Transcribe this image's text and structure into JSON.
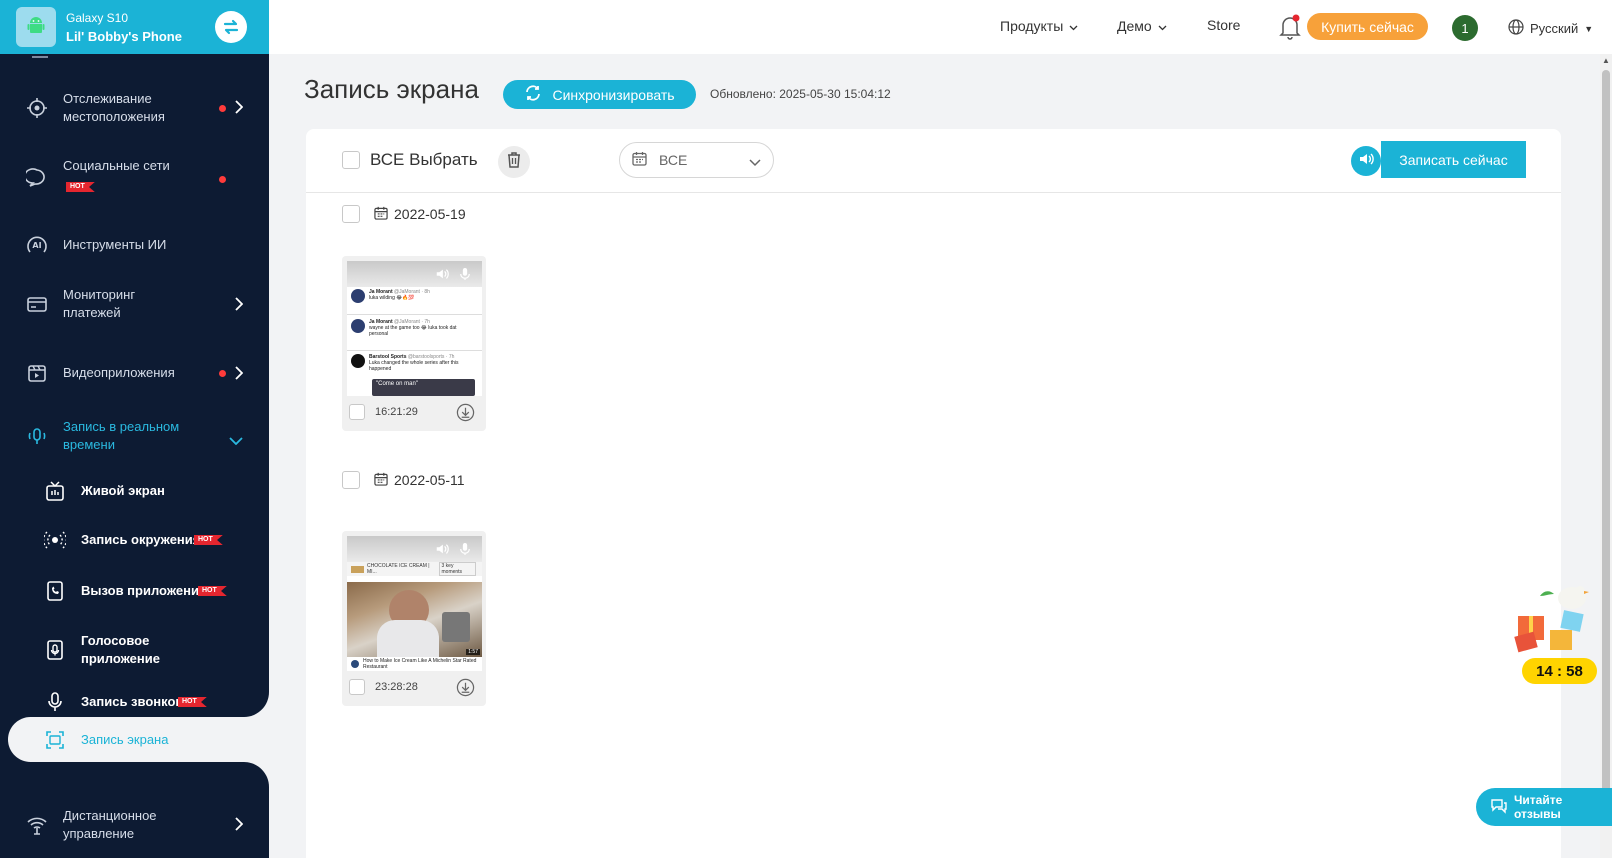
{
  "device": {
    "model": "Galaxy S10",
    "name": "Lil' Bobby's Phone"
  },
  "sidebar": {
    "items": [
      {
        "label": "Отслеживание местоположения",
        "has_dot": true,
        "has_chevron": true
      },
      {
        "label": "Социальные сети",
        "hot": "HOT",
        "has_dot": true
      },
      {
        "label": "Инструменты ИИ"
      },
      {
        "label": "Мониторинг платежей",
        "has_chevron": true
      },
      {
        "label": "Видеоприложения",
        "has_dot": true,
        "has_chevron": true
      },
      {
        "label": "Запись в реальном времени",
        "expanded": true
      },
      {
        "label": "Дистанционное управление",
        "has_chevron": true
      }
    ],
    "subitems": [
      {
        "label": "Живой экран"
      },
      {
        "label": "Запись окружения",
        "hot": "HOT"
      },
      {
        "label": "Вызов приложения",
        "hot": "HOT"
      },
      {
        "label": "Голосовое приложение"
      },
      {
        "label": "Запись звонков",
        "hot": "HOT"
      },
      {
        "label": "Запись экрана",
        "active": true
      }
    ]
  },
  "topbar": {
    "products": "Продукты",
    "demo": "Демо",
    "store": "Store",
    "buy": "Купить сейчас",
    "user_badge": "1",
    "language": "Русский"
  },
  "main": {
    "title": "Запись экрана",
    "sync_label": "Синхронизировать",
    "updated": "Обновлено: 2025-05-30 15:04:12",
    "select_all": "ВСЕ Выбрать",
    "date_filter": "ВСЕ",
    "record_now": "Записать сейчас",
    "groups": [
      {
        "date": "2022-05-19",
        "items": [
          {
            "time": "16:21:29",
            "tweets": [
              {
                "author": "Ja Morant",
                "handle": "@JaMorant · 8h",
                "text": "luka wilding 😂🔥💯"
              },
              {
                "author": "Ja Morant",
                "handle": "@JaMorant · 7h",
                "text": "wayne at the game too 😂 luka took dat personal"
              },
              {
                "author": "Barstool Sports",
                "handle": "@barstoolsports · 7h",
                "text": "Luka changed the whole series after this happened"
              }
            ],
            "overlay": "\"Come on man\""
          }
        ]
      },
      {
        "date": "2022-05-11",
        "items": [
          {
            "time": "23:28:28",
            "video_header": "CHOCOLATE ICE CREAM | MI...",
            "video_header_tag": "3 key moments",
            "video_duration": "1:57",
            "video_title": "How to Make Ice Cream Like A Michelin Star Rated Restaurant"
          }
        ]
      }
    ]
  },
  "widgets": {
    "timer": "14 : 58",
    "reviews": "Читайте отзывы"
  },
  "colors": {
    "accent": "#1bb3d6",
    "sidebar": "#0d1b33",
    "buy": "#f7a13a",
    "hot": "#e5262f"
  }
}
